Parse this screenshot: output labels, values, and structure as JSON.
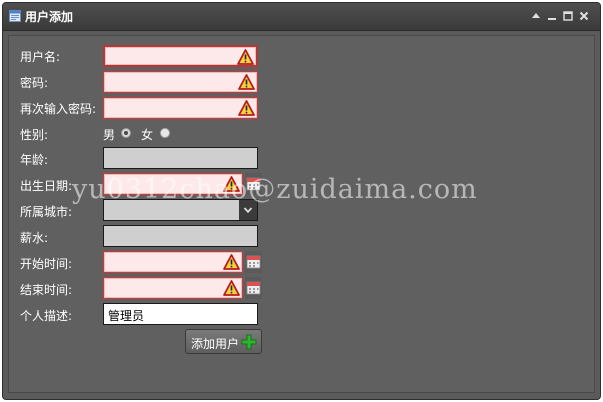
{
  "window": {
    "title": "用户添加",
    "tools": [
      "collapse-icon",
      "minimize-icon",
      "maximize-icon",
      "close-icon"
    ]
  },
  "form": {
    "username": {
      "label": "用户名:",
      "value": ""
    },
    "password": {
      "label": "密码:",
      "value": ""
    },
    "password_confirm": {
      "label": "再次输入密码:",
      "value": ""
    },
    "gender": {
      "label": "性别:",
      "options": [
        {
          "label": "男",
          "selected": true
        },
        {
          "label": "女",
          "selected": false
        }
      ]
    },
    "age": {
      "label": "年龄:",
      "value": ""
    },
    "birthday": {
      "label": "出生日期:",
      "value": ""
    },
    "city": {
      "label": "所属城市:",
      "value": ""
    },
    "salary": {
      "label": "薪水:",
      "value": ""
    },
    "start_time": {
      "label": "开始时间:",
      "value": ""
    },
    "end_time": {
      "label": "结束时间:",
      "value": ""
    },
    "description": {
      "label": "个人描述:",
      "value": "管理员"
    },
    "submit_label": "添加用户"
  },
  "watermark": "yu0312chao@zuidaima.com",
  "colors": {
    "window_bg": "#5b5b5b",
    "invalid_bg": "#fde9ea",
    "invalid_border": "#c63a3a",
    "add_icon": "#2db52d"
  }
}
